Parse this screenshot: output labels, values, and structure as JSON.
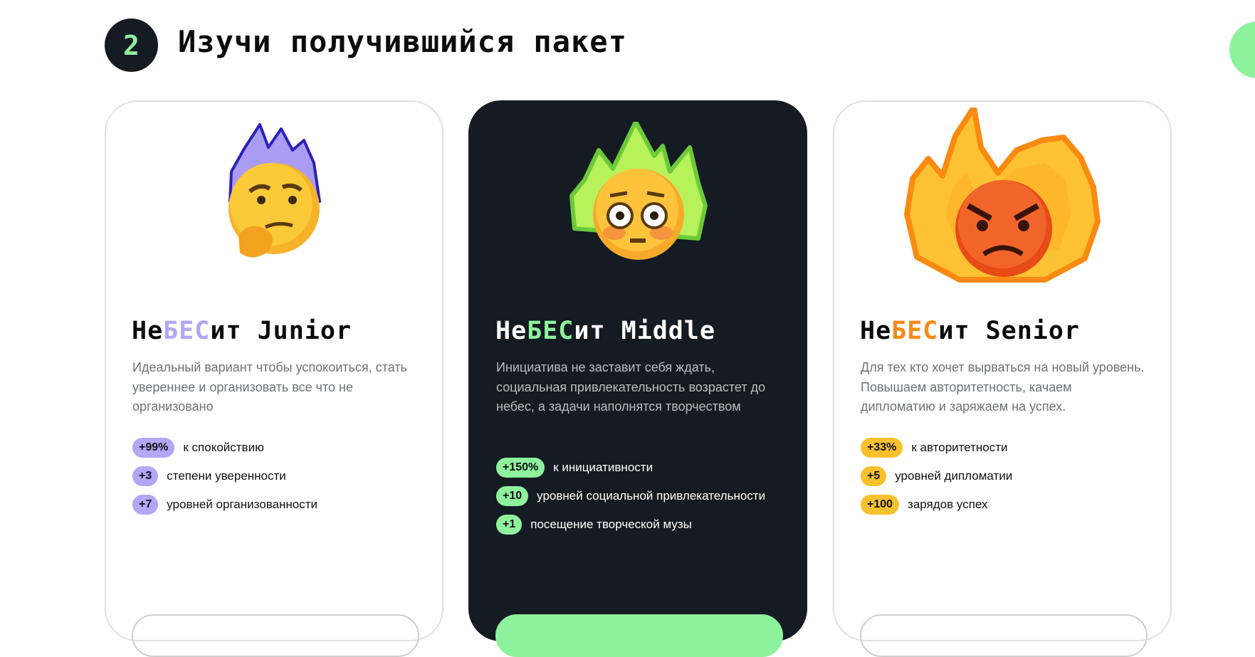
{
  "section": {
    "step_number": "2",
    "title": "Изучи получившийся пакет"
  },
  "colors": {
    "dark": "#141b22",
    "green": "#8ef29d",
    "purple": "#b3a6f5",
    "yellow": "#f8c12d"
  },
  "cards": [
    {
      "title_prefix": "Не",
      "title_highlight": "БЕС",
      "title_suffix": "ит Junior",
      "accent": "#b3a6f5",
      "emoji": "thinking-face-purple-flame-icon",
      "description": "Идеальный вариант чтобы успокоиться, стать увереннее и организовать все что не организовано",
      "stats": [
        {
          "value": "+99%",
          "label": "к спокойствию"
        },
        {
          "value": "+3",
          "label": "степени уверенности"
        },
        {
          "value": "+7",
          "label": "уровней организованности"
        }
      ]
    },
    {
      "title_prefix": "Не",
      "title_highlight": "БЕС",
      "title_suffix": "ит Middle",
      "accent": "#8ef29d",
      "emoji": "flushed-face-green-flame-icon",
      "description": "Инициатива не заставит себя ждать, социальная привлекательность возрастет до небес, а задачи наполнятся творчеством",
      "stats": [
        {
          "value": "+150%",
          "label": "к инициативности"
        },
        {
          "value": "+10",
          "label": "уровней социальной привлекательности"
        },
        {
          "value": "+1",
          "label": "посещение творческой музы"
        }
      ]
    },
    {
      "title_prefix": "Не",
      "title_highlight": "БЕС",
      "title_suffix": "ит Senior",
      "accent": "#f8c12d",
      "emoji": "angry-face-orange-flame-icon",
      "description": "Для тех кто хочет вырваться на новый уровень. Повышаем авторитетность, качаем дипломатию и заряжаем на успех.",
      "stats": [
        {
          "value": "+33%",
          "label": "к авторитетности"
        },
        {
          "value": "+5",
          "label": "уровней дипломатии"
        },
        {
          "value": "+100",
          "label": "зарядов успех"
        }
      ]
    }
  ]
}
